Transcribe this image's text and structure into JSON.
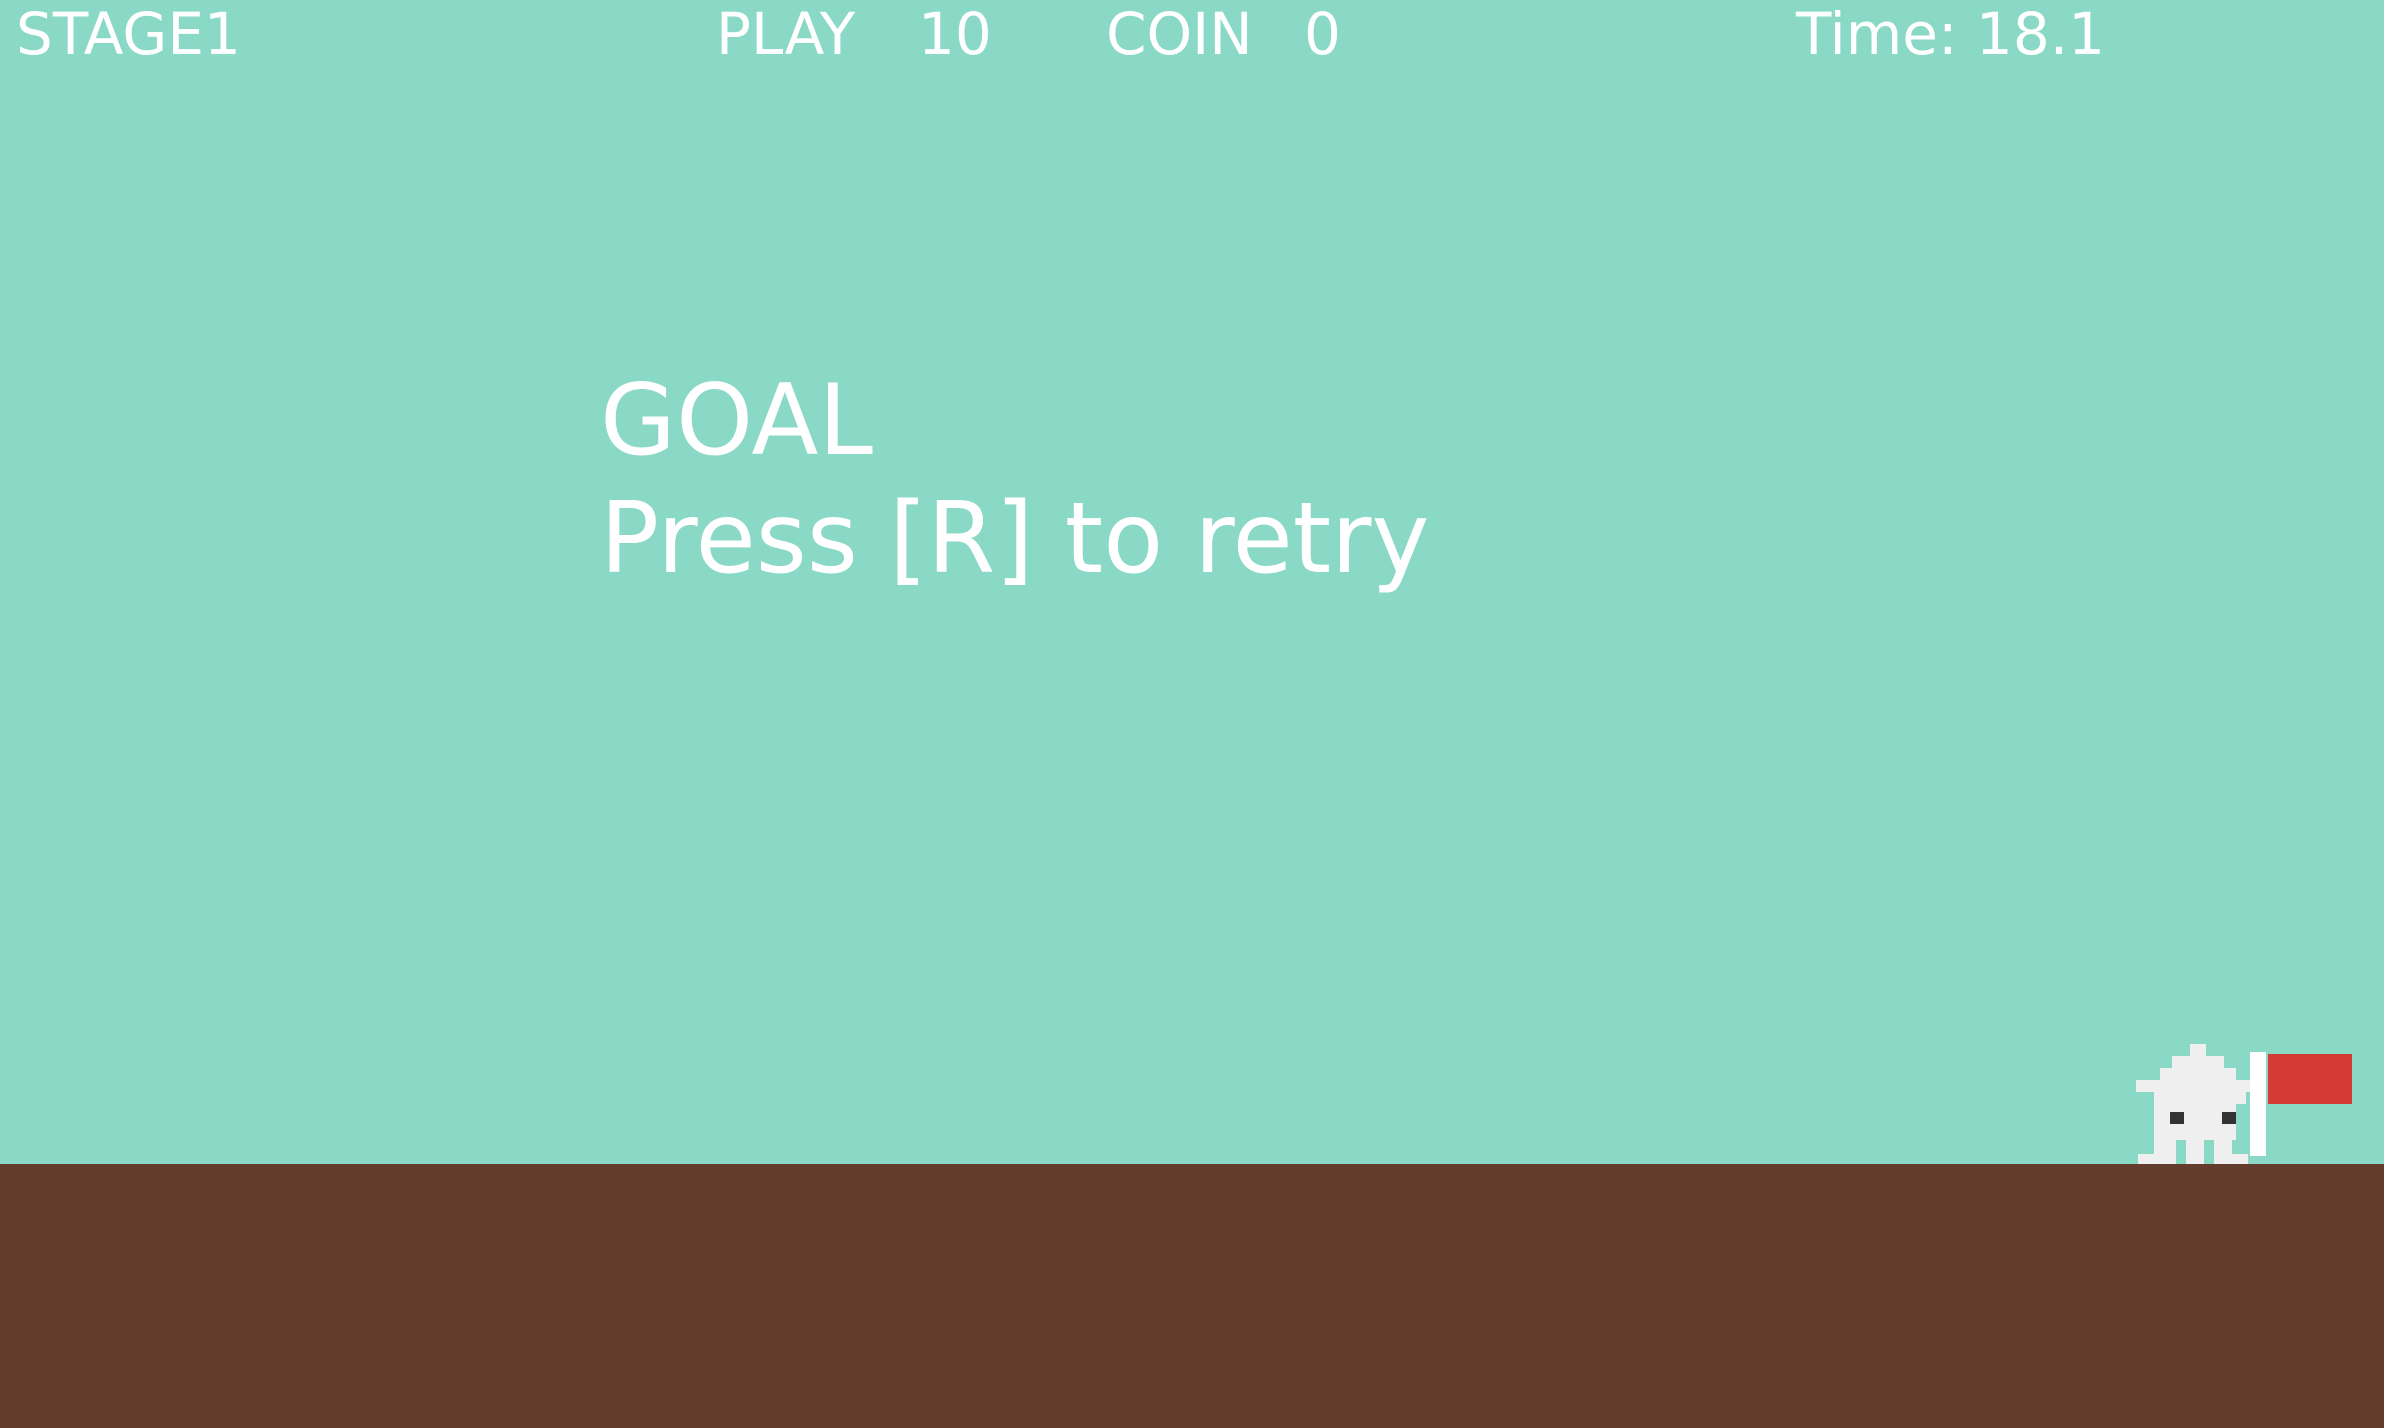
{
  "hud": {
    "stage": "STAGE1",
    "play_label": "PLAY",
    "play_value": "10",
    "coin_label": "COIN",
    "coin_value": "0",
    "time": "Time: 18.1"
  },
  "message": {
    "title": "GOAL",
    "subtitle": "Press [R] to retry"
  },
  "colors": {
    "sky": "#8ad8c6",
    "ground": "#643c2d",
    "text": "#ffffff",
    "player": "#efefef",
    "player_eyes": "#333333",
    "flag": "#d53a33",
    "flag_pole": "#ffffff"
  },
  "sprites": {
    "player": "pixel-creature-icon",
    "goal": "goal-flag-icon"
  }
}
